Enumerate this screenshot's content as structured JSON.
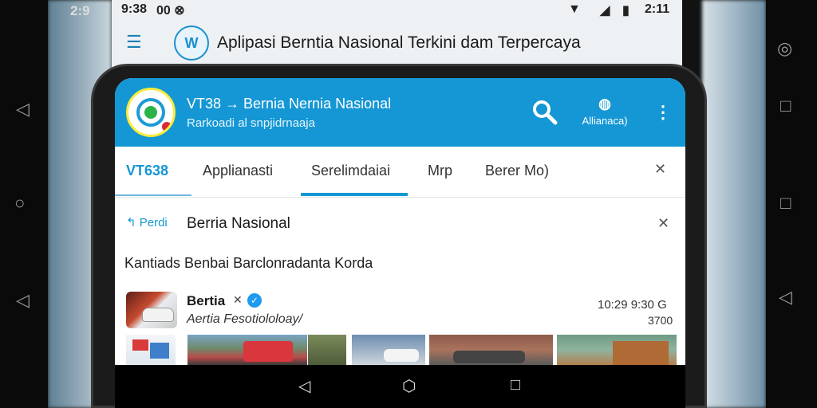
{
  "background": {
    "status_left": "2:9",
    "status_time_left": "9:38",
    "status_icons_left": "00 ⊗",
    "status_time_right": "2:11",
    "page_title": "Aplipasi Berntia Nasional Terkini dam  Terpercaya"
  },
  "app": {
    "title": "VT38  → Bernia Nernia Nasional",
    "subtitle": "Rarkoadi al snpjidrnaaja",
    "account_icon": "◍",
    "account_label": "Allianaca)",
    "more_icon": "⋮"
  },
  "tabs": {
    "items": [
      {
        "label": "VT638"
      },
      {
        "label": "Applianasti"
      },
      {
        "label": "Serelimdaiai"
      },
      {
        "label": "Mrp"
      },
      {
        "label": "Berer Mo)"
      }
    ],
    "close": "✕"
  },
  "crumb": {
    "back_label": "Perdi",
    "title": "Berria Nasional",
    "close": "✕"
  },
  "section": {
    "title": "Kantiads Benbai Barclonradanta Korda"
  },
  "news": {
    "source": "Bertia",
    "x_mark": "✕",
    "verified_icon": "✓",
    "description": "Aertia Fesotiololoay/",
    "time": "10:29 9:30 G",
    "count": "3700"
  },
  "colors": {
    "accent": "#1497d4",
    "appbar": "#1497d4"
  },
  "icons": {
    "menu": "hamburger-icon",
    "search": "search-icon",
    "account": "account-icon",
    "more": "more-vertical-icon",
    "back": "back-icon",
    "home": "home-icon",
    "recents": "recents-icon"
  }
}
